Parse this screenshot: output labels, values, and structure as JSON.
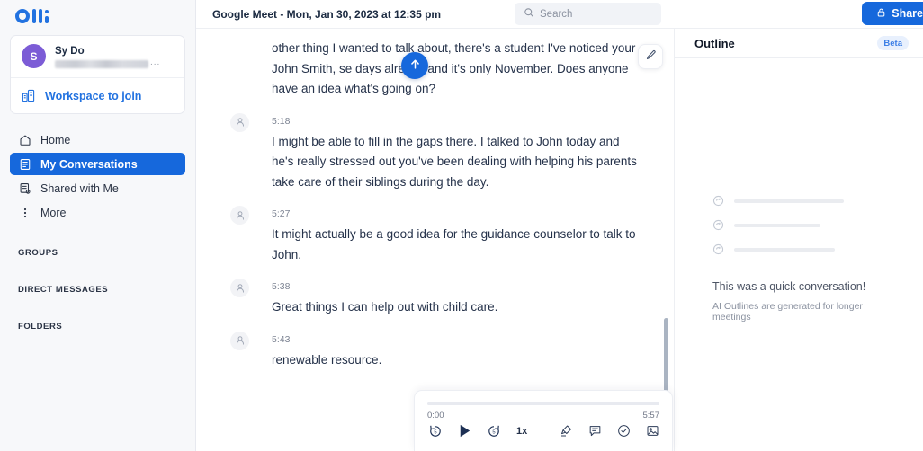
{
  "brand": {
    "logo_name": "otter-logo",
    "accent": "#1668dc",
    "avatar_color": "#7c5cd6"
  },
  "sidebar": {
    "profile": {
      "avatar_initial": "S",
      "name": "Sy Do",
      "email_redacted": "",
      "email_ellipsis": "..."
    },
    "workspace": {
      "label": "Workspace to join"
    },
    "nav": [
      {
        "label": "Home",
        "icon": "home-icon",
        "active": false
      },
      {
        "label": "My Conversations",
        "icon": "conversations-icon",
        "active": true
      },
      {
        "label": "Shared with Me",
        "icon": "shared-icon",
        "active": false
      },
      {
        "label": "More",
        "icon": "more-vertical-icon",
        "active": false
      }
    ],
    "sections": [
      {
        "label": "GROUPS"
      },
      {
        "label": "DIRECT MESSAGES"
      },
      {
        "label": "FOLDERS"
      }
    ]
  },
  "topbar": {
    "doc_title": "Google Meet - Mon, Jan 30, 2023 at 12:35 pm",
    "search_placeholder": "Search",
    "search_value": "",
    "share_label": "Share"
  },
  "transcript": {
    "partial_first": {
      "text": "other thing I wanted to talk about, there's a student I've noticed your John Smith, se days already and it's only November. Does anyone have an idea what's going on?"
    },
    "messages": [
      {
        "time": "5:18",
        "text": "I might be able to fill in the gaps there. I talked to John today and he's really stressed out you've been dealing with helping his parents take care of their siblings during the day."
      },
      {
        "time": "5:27",
        "text": "It might actually be a good idea for the guidance counselor to talk to John."
      },
      {
        "time": "5:38",
        "text": "Great things I can help out with child care."
      },
      {
        "time": "5:43",
        "text": "renewable resource."
      }
    ],
    "scroll_up_label": "Scroll to top",
    "edit_label": "Edit transcript"
  },
  "player": {
    "current_time": "0:00",
    "total_time": "5:57",
    "progress_percent": 0,
    "speed": "1x",
    "controls": [
      {
        "name": "skip-back-5-icon"
      },
      {
        "name": "play-icon"
      },
      {
        "name": "skip-forward-5-icon"
      },
      {
        "name": "playback-speed-button"
      }
    ],
    "tools": [
      {
        "name": "highlight-icon"
      },
      {
        "name": "comment-icon"
      },
      {
        "name": "action-item-icon"
      },
      {
        "name": "image-icon"
      }
    ]
  },
  "outline": {
    "title": "Outline",
    "badge": "Beta",
    "empty_title": "This was a quick conversation!",
    "empty_subtitle": "AI Outlines are generated for longer meetings",
    "skeleton_widths": [
      "122px",
      "96px",
      "112px"
    ]
  }
}
